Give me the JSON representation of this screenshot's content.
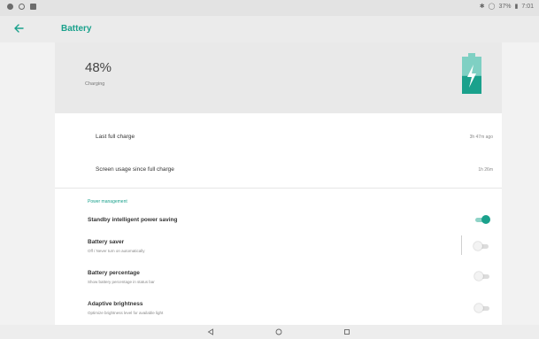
{
  "status_bar": {
    "left_icons": [
      "notification-icon",
      "sync-icon",
      "image-icon"
    ],
    "right_text": "37%",
    "time": "7:01"
  },
  "app_bar": {
    "back_icon": "arrow-back-icon",
    "title": "Battery"
  },
  "battery_header": {
    "percent": "48%",
    "status": "Charging",
    "level": 0.48,
    "accent_color": "#1aa18c"
  },
  "usage_rows": [
    {
      "label": "Last full charge",
      "value": "3h 47m ago"
    },
    {
      "label": "Screen usage since full charge",
      "value": "1h 26m"
    }
  ],
  "power_management": {
    "section_title": "Power management",
    "items": [
      {
        "title": "Standby intelligent power saving",
        "subtitle": "",
        "toggle_on": true
      },
      {
        "title": "Battery saver",
        "subtitle": "Off / Never turn on automatically",
        "toggle_on": false
      },
      {
        "title": "Battery percentage",
        "subtitle": "Show battery percentage in status bar",
        "toggle_on": false
      },
      {
        "title": "Adaptive brightness",
        "subtitle": "Optimize brightness level for available light",
        "toggle_on": false
      }
    ]
  },
  "nav_bar": {
    "back": "back-triangle-icon",
    "home": "home-circle-icon",
    "recents": "recents-square-icon"
  }
}
